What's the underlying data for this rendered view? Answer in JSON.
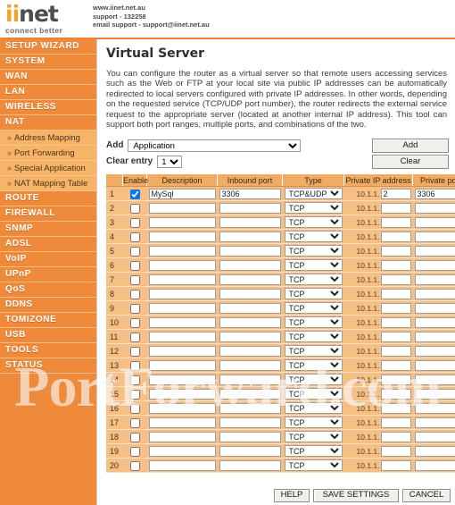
{
  "header": {
    "logo": {
      "part1": "ii",
      "part2": "net",
      "tagline": "connect better"
    },
    "contact": {
      "website": "www.iinet.net.au",
      "support": "support - 132258",
      "email": "email support - support@iinet.net.au"
    }
  },
  "sidebar": {
    "items": [
      {
        "label": "SETUP WIZARD",
        "type": "main"
      },
      {
        "label": "SYSTEM",
        "type": "main"
      },
      {
        "label": "WAN",
        "type": "main"
      },
      {
        "label": "LAN",
        "type": "main"
      },
      {
        "label": "WIRELESS",
        "type": "main"
      },
      {
        "label": "NAT",
        "type": "main"
      },
      {
        "label": "Address Mapping",
        "type": "sub"
      },
      {
        "label": "Port Forwarding",
        "type": "sub"
      },
      {
        "label": "Special Application",
        "type": "sub"
      },
      {
        "label": "NAT Mapping Table",
        "type": "sub"
      },
      {
        "label": "ROUTE",
        "type": "main"
      },
      {
        "label": "FIREWALL",
        "type": "main"
      },
      {
        "label": "SNMP",
        "type": "main"
      },
      {
        "label": "ADSL",
        "type": "main"
      },
      {
        "label": "VoIP",
        "type": "main"
      },
      {
        "label": "UPnP",
        "type": "main"
      },
      {
        "label": "QoS",
        "type": "main"
      },
      {
        "label": "DDNS",
        "type": "main"
      },
      {
        "label": "TOMIZONE",
        "type": "main"
      },
      {
        "label": "USB",
        "type": "main"
      },
      {
        "label": "TOOLS",
        "type": "main"
      },
      {
        "label": "STATUS",
        "type": "main"
      }
    ]
  },
  "main": {
    "title": "Virtual Server",
    "description": "You can configure the router as a virtual server so that remote users accessing services such as the Web or FTP at your local site via public IP addresses can be automatically redirected to local servers configured with private IP addresses. In other words, depending on the requested service (TCP/UDP port number), the router redirects the external service request to the appropriate server (located at another internal IP address). This tool can support both port ranges, multiple ports, and combinations of the two.",
    "add_row": {
      "add_label": "Add",
      "application_value": "Application",
      "clear_entry_label": "Clear entry",
      "clear_entry_value": "1",
      "add_button": "Add",
      "clear_button": "Clear"
    },
    "table": {
      "headers": [
        "",
        "Enable",
        "Description",
        "Inbound port",
        "Type",
        "Private IP address",
        "Private port"
      ],
      "ip_prefix": "10.1.1.",
      "type_options": [
        "TCP",
        "UDP",
        "TCP&UDP"
      ],
      "rows": [
        {
          "idx": "1",
          "enabled": true,
          "description": "MySql",
          "inbound_port": "3306",
          "type": "TCP&UDP",
          "private_ip": "2",
          "private_port": "3306"
        },
        {
          "idx": "2",
          "enabled": false,
          "description": "",
          "inbound_port": "",
          "type": "TCP",
          "private_ip": "",
          "private_port": ""
        },
        {
          "idx": "3",
          "enabled": false,
          "description": "",
          "inbound_port": "",
          "type": "TCP",
          "private_ip": "",
          "private_port": ""
        },
        {
          "idx": "4",
          "enabled": false,
          "description": "",
          "inbound_port": "",
          "type": "TCP",
          "private_ip": "",
          "private_port": ""
        },
        {
          "idx": "5",
          "enabled": false,
          "description": "",
          "inbound_port": "",
          "type": "TCP",
          "private_ip": "",
          "private_port": ""
        },
        {
          "idx": "6",
          "enabled": false,
          "description": "",
          "inbound_port": "",
          "type": "TCP",
          "private_ip": "",
          "private_port": ""
        },
        {
          "idx": "7",
          "enabled": false,
          "description": "",
          "inbound_port": "",
          "type": "TCP",
          "private_ip": "",
          "private_port": ""
        },
        {
          "idx": "8",
          "enabled": false,
          "description": "",
          "inbound_port": "",
          "type": "TCP",
          "private_ip": "",
          "private_port": ""
        },
        {
          "idx": "9",
          "enabled": false,
          "description": "",
          "inbound_port": "",
          "type": "TCP",
          "private_ip": "",
          "private_port": ""
        },
        {
          "idx": "10",
          "enabled": false,
          "description": "",
          "inbound_port": "",
          "type": "TCP",
          "private_ip": "",
          "private_port": ""
        },
        {
          "idx": "11",
          "enabled": false,
          "description": "",
          "inbound_port": "",
          "type": "TCP",
          "private_ip": "",
          "private_port": ""
        },
        {
          "idx": "12",
          "enabled": false,
          "description": "",
          "inbound_port": "",
          "type": "TCP",
          "private_ip": "",
          "private_port": ""
        },
        {
          "idx": "13",
          "enabled": false,
          "description": "",
          "inbound_port": "",
          "type": "TCP",
          "private_ip": "",
          "private_port": ""
        },
        {
          "idx": "14",
          "enabled": false,
          "description": "",
          "inbound_port": "",
          "type": "TCP",
          "private_ip": "",
          "private_port": ""
        },
        {
          "idx": "15",
          "enabled": false,
          "description": "",
          "inbound_port": "",
          "type": "TCP",
          "private_ip": "",
          "private_port": ""
        },
        {
          "idx": "16",
          "enabled": false,
          "description": "",
          "inbound_port": "",
          "type": "TCP",
          "private_ip": "",
          "private_port": ""
        },
        {
          "idx": "17",
          "enabled": false,
          "description": "",
          "inbound_port": "",
          "type": "TCP",
          "private_ip": "",
          "private_port": ""
        },
        {
          "idx": "18",
          "enabled": false,
          "description": "",
          "inbound_port": "",
          "type": "TCP",
          "private_ip": "",
          "private_port": ""
        },
        {
          "idx": "19",
          "enabled": false,
          "description": "",
          "inbound_port": "",
          "type": "TCP",
          "private_ip": "",
          "private_port": ""
        },
        {
          "idx": "20",
          "enabled": false,
          "description": "",
          "inbound_port": "",
          "type": "TCP",
          "private_ip": "",
          "private_port": ""
        }
      ]
    },
    "footer": {
      "help": "HELP",
      "save": "SAVE SETTINGS",
      "cancel": "CANCEL"
    }
  },
  "watermark": {
    "text": "PortForward.com"
  },
  "colors": {
    "brand_orange": "#ef8a3a",
    "sub_orange": "#f7b469",
    "table_row": "#f6bf86",
    "table_header": "#f2ab63"
  }
}
